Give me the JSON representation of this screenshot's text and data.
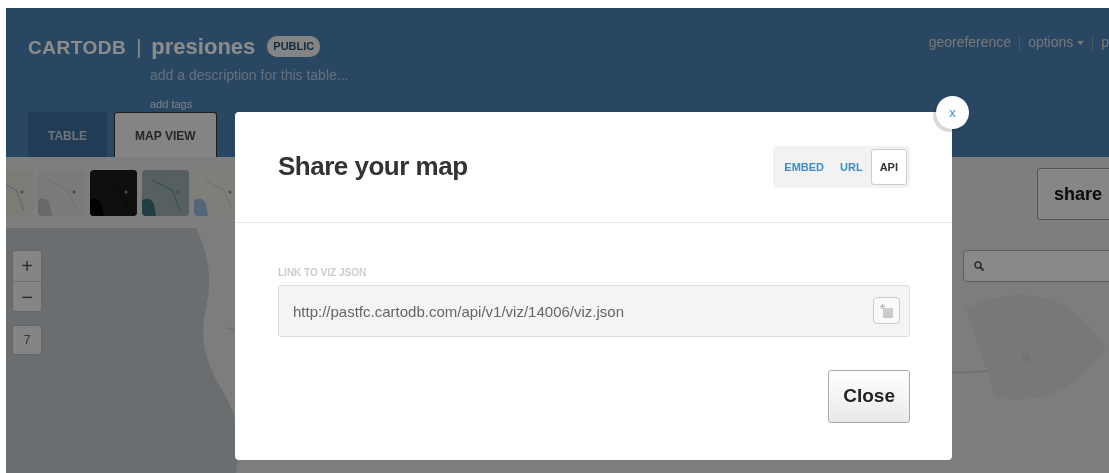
{
  "header": {
    "logo": "CARTODB",
    "separator": "|",
    "table_name": "presiones",
    "privacy_badge": "PUBLIC",
    "description_placeholder": "add a description for this table...",
    "tags_link": "add tags",
    "menu": [
      {
        "label": "georeference",
        "dropdown": false
      },
      {
        "label": "options",
        "dropdown": true
      },
      {
        "label": "p",
        "dropdown": false
      }
    ]
  },
  "tabs": [
    {
      "label": "TABLE",
      "selected": false
    },
    {
      "label": "MAP VIEW",
      "selected": true
    }
  ],
  "map": {
    "share_button": "share",
    "zoom_in": "+",
    "zoom_out": "−",
    "zoom_level": "7"
  },
  "modal": {
    "title": "Share your map",
    "close_icon": "x",
    "modes": [
      {
        "label": "EMBED",
        "selected": false
      },
      {
        "label": "URL",
        "selected": false
      },
      {
        "label": "API",
        "selected": true
      }
    ],
    "field_label": "LINK TO VIZ JSON",
    "url": "http://pastfc.cartodb.com/api/v1/viz/14006/viz.json",
    "close_button": "Close"
  }
}
